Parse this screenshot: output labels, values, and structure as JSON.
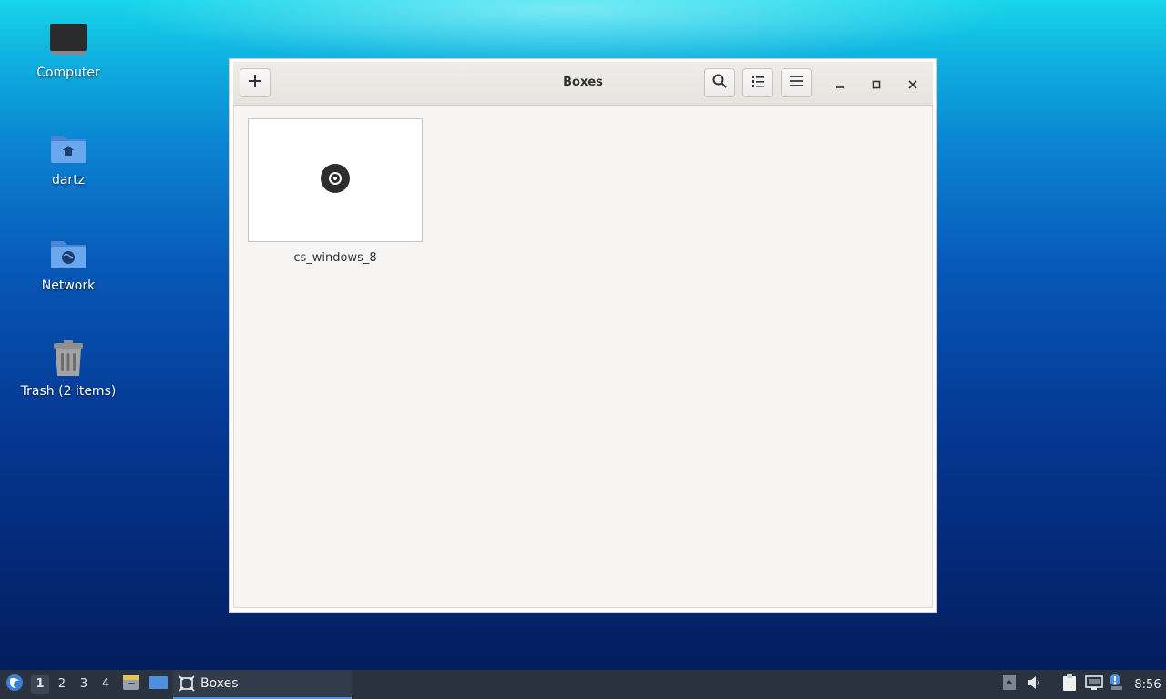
{
  "desktop": {
    "icons": [
      {
        "label": "Computer",
        "icon": "computer-icon"
      },
      {
        "label": "dartz",
        "icon": "home-folder-icon"
      },
      {
        "label": "Network",
        "icon": "network-folder-icon"
      },
      {
        "label": "Trash (2 items)",
        "icon": "trash-icon"
      }
    ]
  },
  "window": {
    "title": "Boxes",
    "buttons": {
      "new": "plus-icon",
      "search": "search-icon",
      "view": "list-view-icon",
      "menu": "hamburger-menu-icon",
      "minimize": "minimize-icon",
      "maximize": "maximize-icon",
      "close": "close-icon"
    },
    "vms": [
      {
        "name": "cs_windows_8",
        "thumbnail": "disc-icon"
      }
    ]
  },
  "taskbar": {
    "workspaces": [
      "1",
      "2",
      "3",
      "4"
    ],
    "active_workspace": "1",
    "launchers": [
      "file-manager-icon",
      "desktop-icon"
    ],
    "tasks": [
      {
        "label": "Boxes",
        "icon": "boxes-app-icon"
      }
    ],
    "tray": [
      "tray-expand-icon",
      "volume-icon",
      "clipboard-icon",
      "network-icon",
      "notification-icon"
    ],
    "clock": "8:56"
  },
  "colors": {
    "accent": "#4f8fe0",
    "taskbar_bg": "#2a3240",
    "folder_blue": "#5b9be8"
  }
}
